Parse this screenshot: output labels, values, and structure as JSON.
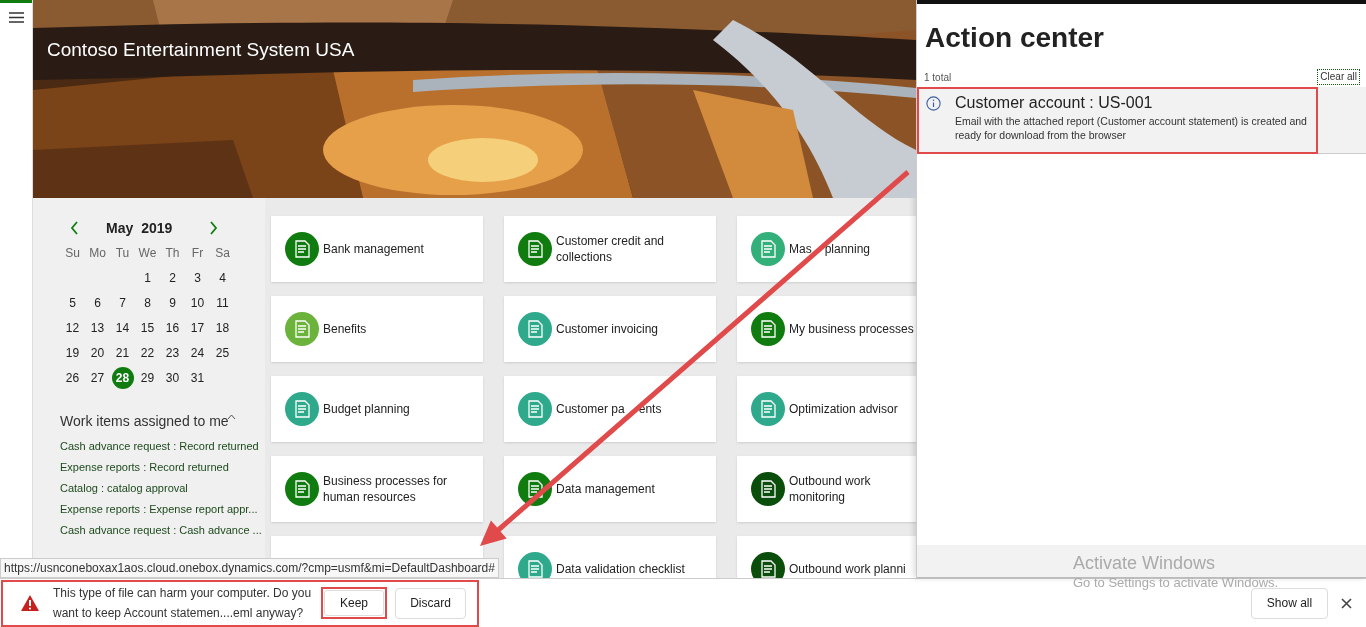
{
  "banner": {
    "title": "Contoso Entertainment System USA"
  },
  "calendar": {
    "month": "May",
    "year": "2019",
    "weekdays": [
      "Su",
      "Mo",
      "Tu",
      "We",
      "Th",
      "Fr",
      "Sa"
    ],
    "weeks": [
      {
        "starts_mid_week": true,
        "days": [
          {
            "day": "1",
            "selected": false
          },
          {
            "day": "2",
            "selected": false
          },
          {
            "day": "3",
            "selected": false
          },
          {
            "day": "4",
            "selected": false
          }
        ]
      },
      {
        "days": [
          {
            "day": "5",
            "selected": false
          },
          {
            "day": "6",
            "selected": false
          },
          {
            "day": "7",
            "selected": false
          },
          {
            "day": "8",
            "selected": false
          },
          {
            "day": "9",
            "selected": false
          },
          {
            "day": "10",
            "selected": false
          },
          {
            "day": "11",
            "selected": false
          }
        ]
      },
      {
        "days": [
          {
            "day": "12",
            "selected": false
          },
          {
            "day": "13",
            "selected": false
          },
          {
            "day": "14",
            "selected": false
          },
          {
            "day": "15",
            "selected": false
          },
          {
            "day": "16",
            "selected": false
          },
          {
            "day": "17",
            "selected": false
          },
          {
            "day": "18",
            "selected": false
          }
        ]
      },
      {
        "days": [
          {
            "day": "19",
            "selected": false
          },
          {
            "day": "20",
            "selected": false
          },
          {
            "day": "21",
            "selected": false
          },
          {
            "day": "22",
            "selected": false
          },
          {
            "day": "23",
            "selected": false
          },
          {
            "day": "24",
            "selected": false
          },
          {
            "day": "25",
            "selected": false
          }
        ]
      },
      {
        "starts_mid_week": false,
        "days": [
          {
            "day": "26",
            "selected": false
          },
          {
            "day": "27",
            "selected": false
          },
          {
            "day": "28",
            "selected": true
          },
          {
            "day": "29",
            "selected": false
          },
          {
            "day": "30",
            "selected": false
          },
          {
            "day": "31",
            "selected": false
          }
        ]
      }
    ]
  },
  "work_items": {
    "title": "Work items assigned to me",
    "items": [
      "Cash advance request : Record returned",
      "Expense reports : Record returned",
      "Catalog : catalog approval",
      "Expense reports : Expense report appr...",
      "Cash advance request : Cash advance ..."
    ]
  },
  "tiles": [
    {
      "label": "Bank management",
      "color": "#107c10"
    },
    {
      "label": "Customer credit and collections",
      "color": "#107c10"
    },
    {
      "label": [
        "Mas",
        "planning"
      ],
      "color": "#33b07a"
    },
    {
      "label": "Benefits",
      "color": "#6bb33b"
    },
    {
      "label": "Customer invoicing",
      "color": "#2fa98b"
    },
    {
      "label": "My business processes",
      "color": "#107c10"
    },
    {
      "label": "Budget planning",
      "color": "#2fa98b"
    },
    {
      "label": [
        "Customer pa",
        "ents"
      ],
      "color": "#2fa98b"
    },
    {
      "label": "Optimization advisor",
      "color": "#2fa98b"
    },
    {
      "label": "Business processes for human resources",
      "color": "#107c10"
    },
    {
      "label": "Data management",
      "color": "#107c10"
    },
    {
      "label": "Outbound work monitoring",
      "color": "#0b4d0b"
    },
    {
      "kind": "covered"
    },
    {
      "label": "Data validation checklist",
      "color": "#2fa98b"
    },
    {
      "label": "Outbound work planni",
      "color": "#0b4d0b"
    }
  ],
  "action_center": {
    "title": "Action center",
    "total": "1 total",
    "clear_all": "Clear all",
    "notifications": [
      {
        "title": "Customer account : US-001",
        "message": "Email with the attached report (Customer account statement) is created and ready for download from the browser"
      }
    ]
  },
  "windows_notice": {
    "title": "Activate Windows",
    "subtitle": "Go to Settings to activate Windows."
  },
  "status_url": "https://usnconeboxax1aos.cloud.onebox.dynamics.com/?cmp=usmf&mi=DefaultDashboard#",
  "download_bar": {
    "message": "This type of file can harm your computer. Do you want to keep Account statemen....eml anyway?",
    "buttons": [
      "Keep",
      "Discard"
    ],
    "show_all": "Show all"
  }
}
